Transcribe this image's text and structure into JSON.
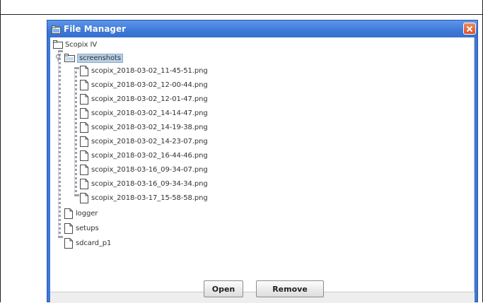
{
  "window": {
    "title": "File Manager"
  },
  "tree": {
    "root": "Scopix IV",
    "folder": "screenshots",
    "files": [
      "scopix_2018-03-02_11-45-51.png",
      "scopix_2018-03-02_12-00-44.png",
      "scopix_2018-03-02_12-01-47.png",
      "scopix_2018-03-02_14-14-47.png",
      "scopix_2018-03-02_14-19-38.png",
      "scopix_2018-03-02_14-23-07.png",
      "scopix_2018-03-02_16-44-46.png",
      "scopix_2018-03-16_09-34-07.png",
      "scopix_2018-03-16_09-34-34.png",
      "scopix_2018-03-17_15-58-58.png"
    ],
    "other_items": [
      "logger",
      "setups",
      "sdcard_p1"
    ]
  },
  "buttons": {
    "open": "Open",
    "remove": "Remove"
  },
  "colors": {
    "titlebar": "#3f7bd9",
    "selection": "#b8cfe5",
    "close": "#d8502a"
  },
  "icons": {
    "app": "folder-app-icon",
    "close": "close-icon",
    "root": "root-folder-icon",
    "folder": "open-folder-icon",
    "file": "file-icon",
    "expand": "expanded-handle-icon"
  }
}
